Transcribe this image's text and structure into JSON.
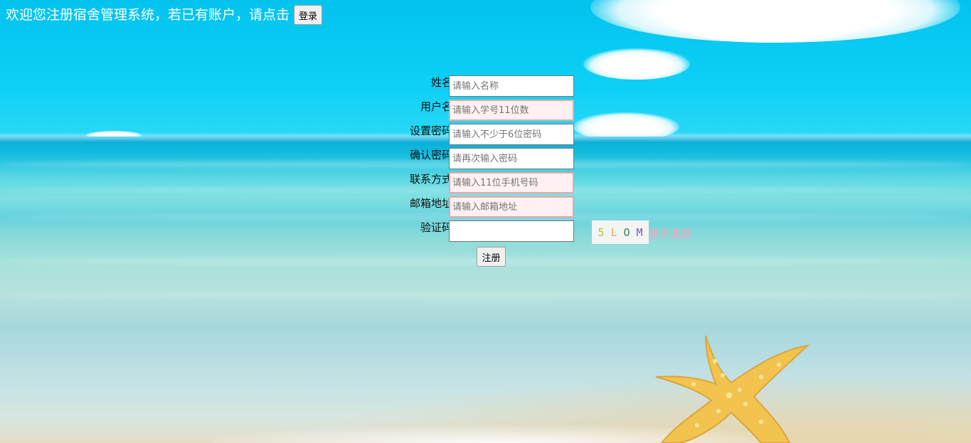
{
  "header": {
    "welcome_text": "欢迎您注册宿舍管理系统，若已有账户，请点击",
    "login_label": "登录"
  },
  "form": {
    "fields": [
      {
        "label": "姓名:",
        "placeholder": "请输入名称",
        "value": "",
        "invalid": false
      },
      {
        "label": "用户名:",
        "placeholder": "请输入学号11位数",
        "value": "",
        "invalid": true
      },
      {
        "label": "设置密码:",
        "placeholder": "请输入不少于6位密码",
        "value": "",
        "invalid": false
      },
      {
        "label": "确认密码:",
        "placeholder": "请再次输入密码",
        "value": "",
        "invalid": false
      },
      {
        "label": "联系方式:",
        "placeholder": "请输入11位手机号码",
        "value": "",
        "invalid": true
      },
      {
        "label": "邮箱地址:",
        "placeholder": "请输入邮箱地址",
        "value": "",
        "invalid": true
      },
      {
        "label": "验证码:",
        "placeholder": "",
        "value": "",
        "invalid": false
      }
    ],
    "captcha": {
      "chars": [
        "5",
        "L",
        "O",
        "M"
      ],
      "colors": [
        "#9acd32",
        "#f4a460",
        "#2e8b57",
        "#6a5acd"
      ],
      "refresh_label": "看不清楚"
    },
    "register_label": "注册"
  },
  "colors": {
    "invalid_border": "#f2a3a3",
    "invalid_background": "#fff1f1",
    "refresh_link": "#f5a6b8"
  }
}
